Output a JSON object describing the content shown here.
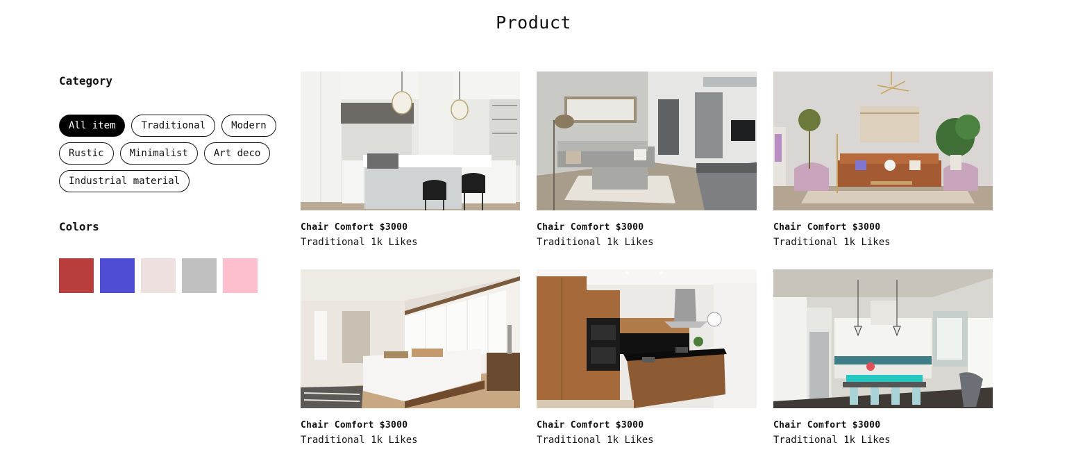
{
  "page": {
    "title": "Product"
  },
  "sidebar": {
    "category_heading": "Category",
    "categories": [
      {
        "label": "All item",
        "active": true
      },
      {
        "label": "Traditional",
        "active": false
      },
      {
        "label": "Modern",
        "active": false
      },
      {
        "label": "Rustic",
        "active": false
      },
      {
        "label": "Minimalist",
        "active": false
      },
      {
        "label": "Art deco",
        "active": false
      },
      {
        "label": "Industrial material",
        "active": false
      }
    ],
    "colors_heading": "Colors",
    "colors": [
      "#b83d3d",
      "#4e4dd3",
      "#ede0df",
      "#c0c0c0",
      "#fdbfcd"
    ]
  },
  "products": [
    {
      "name": "Chair Comfort",
      "price": "$3000",
      "style": "Traditional",
      "likes": "1k Likes",
      "scene": "white-kitchen"
    },
    {
      "name": "Chair Comfort",
      "price": "$3000",
      "style": "Traditional",
      "likes": "1k Likes",
      "scene": "grey-living-room"
    },
    {
      "name": "Chair Comfort",
      "price": "$3000",
      "style": "Traditional",
      "likes": "1k Likes",
      "scene": "pink-lounge"
    },
    {
      "name": "Chair Comfort",
      "price": "$3000",
      "style": "Traditional",
      "likes": "1k Likes",
      "scene": "white-bedroom"
    },
    {
      "name": "Chair Comfort",
      "price": "$3000",
      "style": "Traditional",
      "likes": "1k Likes",
      "scene": "wood-kitchen"
    },
    {
      "name": "Chair Comfort",
      "price": "$3000",
      "style": "Traditional",
      "likes": "1k Likes",
      "scene": "teal-kitchen"
    }
  ]
}
